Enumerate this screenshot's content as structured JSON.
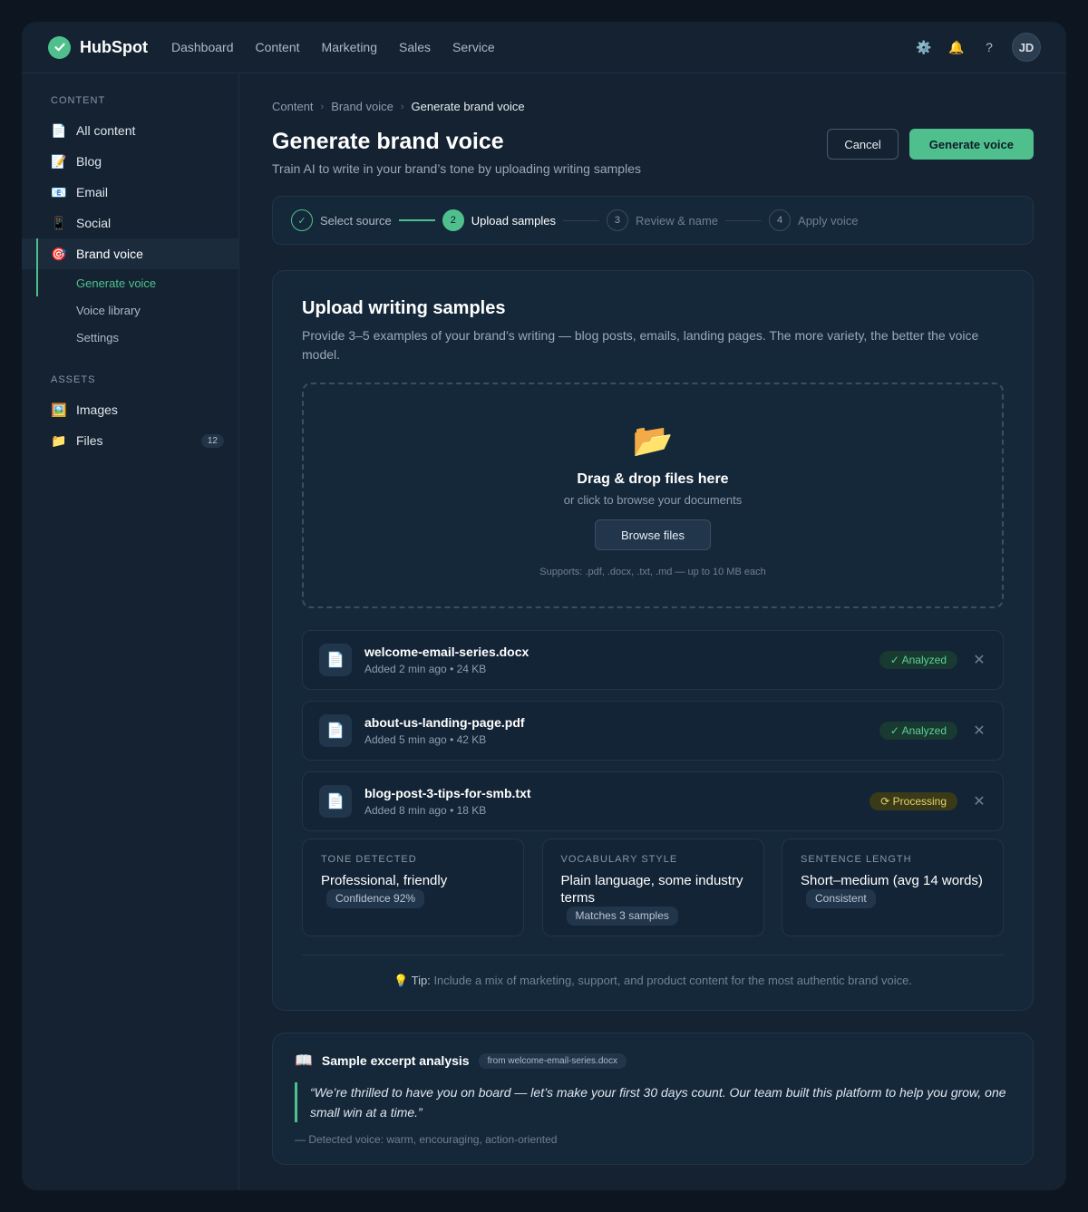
{
  "brand": {
    "name": "HubSpot"
  },
  "nav": {
    "links": [
      "Dashboard",
      "Content",
      "Marketing",
      "Sales",
      "Service"
    ],
    "icons": {
      "settings": "⚙️",
      "notifications": "🔔",
      "help": "?"
    },
    "avatar": "JD"
  },
  "sidebar": {
    "section_content": "CONTENT",
    "items": [
      {
        "icon": "📄",
        "label": "All content"
      },
      {
        "icon": "📝",
        "label": "Blog"
      },
      {
        "icon": "📧",
        "label": "Email"
      },
      {
        "icon": "📱",
        "label": "Social"
      },
      {
        "icon": "🎯",
        "label": "Brand voice"
      }
    ],
    "subitems": [
      "Generate voice",
      "Voice library",
      "Settings"
    ],
    "section_assets": "ASSETS",
    "assets": [
      {
        "icon": "🖼️",
        "label": "Images"
      },
      {
        "icon": "📁",
        "label": "Files",
        "badge": "12"
      }
    ]
  },
  "breadcrumb": [
    "Content",
    "Brand voice",
    "Generate brand voice"
  ],
  "header": {
    "title": "Generate brand voice",
    "subtitle": "Train AI to write in your brand’s tone by uploading writing samples",
    "cancel": "Cancel",
    "generate": "Generate voice"
  },
  "steps": [
    {
      "num": "✓",
      "label": "Select source"
    },
    {
      "num": "2",
      "label": "Upload samples"
    },
    {
      "num": "3",
      "label": "Review & name"
    },
    {
      "num": "4",
      "label": "Apply voice"
    }
  ],
  "upload": {
    "title": "Upload writing samples",
    "description": "Provide 3–5 examples of your brand’s writing — blog posts, emails, landing pages. The more variety, the better the voice model.",
    "dz_icon": "📂",
    "dz_title": "Drag & drop files here",
    "dz_sub": "or click to browse your documents",
    "browse": "Browse files",
    "support": "Supports: .pdf, .docx, .txt, .md — up to 10 MB each"
  },
  "files": [
    {
      "icon": "📄",
      "name": "welcome-email-series.docx",
      "meta": "Added 2 min ago • 24 KB",
      "status": "✓ Analyzed"
    },
    {
      "icon": "📄",
      "name": "about-us-landing-page.pdf",
      "meta": "Added 5 min ago • 42 KB",
      "status": "✓ Analyzed"
    },
    {
      "icon": "📄",
      "name": "blog-post-3-tips-for-smb.txt",
      "meta": "Added 8 min ago • 18 KB",
      "status": "⟳ Processing"
    }
  ],
  "remove_icon": "✕",
  "insights": [
    {
      "label": "TONE DETECTED",
      "value": "Professional, friendly",
      "chip": "Confidence 92%"
    },
    {
      "label": "VOCABULARY STYLE",
      "value": "Plain language, some industry terms",
      "chip": "Matches 3 samples"
    },
    {
      "label": "SENTENCE LENGTH",
      "value": "Short–medium (avg 14 words)",
      "chip": "Consistent"
    }
  ],
  "tip": {
    "icon": "💡",
    "label": "Tip:",
    "text": "Include a mix of marketing, support, and product content for the most authentic brand voice."
  },
  "excerpt": {
    "icon": "📖",
    "title": "Sample excerpt analysis",
    "source": "from welcome-email-series.docx",
    "quote": "“We’re thrilled to have you on board — let’s make your first 30 days count. Our team built this platform to help you grow, one small win at a time.”",
    "voice": "— Detected voice: warm, encouraging, action-oriented"
  }
}
